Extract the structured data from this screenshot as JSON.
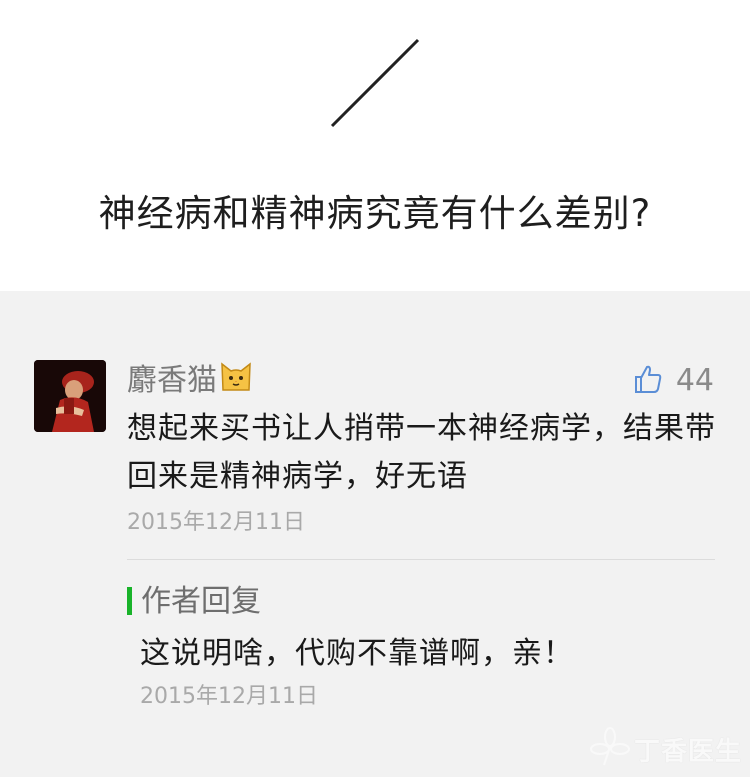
{
  "article": {
    "question": "神经病和精神病究竟有什么差别?"
  },
  "comment": {
    "username": "麝香猫",
    "username_emoji_icon": "cat-face-icon",
    "like_icon": "thumbs-up-icon",
    "likes": "44",
    "text": "想起来买书让人捎带一本神经病学，结果带回来是精神病学，好无语",
    "date": "2015年12月11日"
  },
  "reply": {
    "label": "作者回复",
    "text": "这说明啥，代购不靠谱啊，亲！",
    "date": "2015年12月11日",
    "accent_color": "#19b32a"
  },
  "watermark": {
    "text": "丁香医生"
  }
}
